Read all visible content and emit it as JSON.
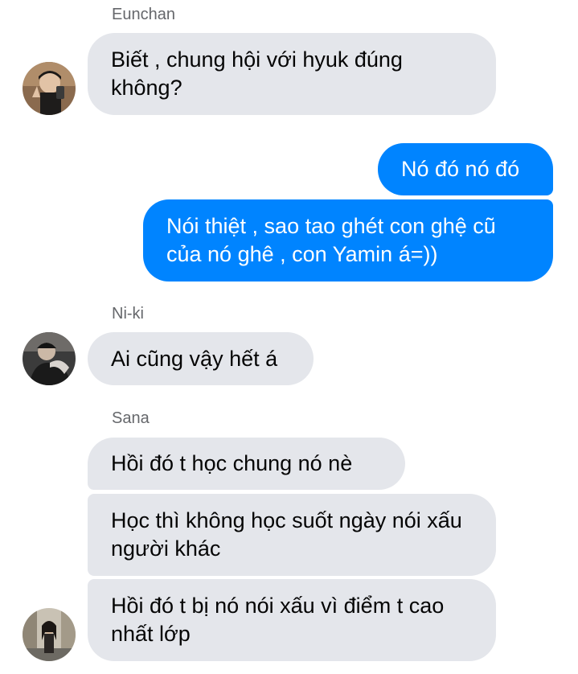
{
  "groups": [
    {
      "sender": "Eunchan",
      "avatar_icon": "user-avatar-eunchan",
      "messages": [
        {
          "text": "Biết , chung hội với hyuk đúng không?"
        }
      ]
    },
    {
      "sender": "me",
      "messages": [
        {
          "text": "Nó đó nó đó"
        },
        {
          "text": "Nói thiệt , sao tao ghét con ghệ cũ của nó ghê , con Yamin á=))"
        }
      ]
    },
    {
      "sender": "Ni-ki",
      "avatar_icon": "user-avatar-niki",
      "messages": [
        {
          "text": "Ai cũng vậy hết á"
        }
      ]
    },
    {
      "sender": "Sana",
      "avatar_icon": "user-avatar-sana",
      "messages": [
        {
          "text": "Hồi đó t học chung nó nè"
        },
        {
          "text": "Học thì không học suốt ngày nói xấu người khác"
        },
        {
          "text": "Hồi đó t bị nó nói xấu vì điểm t cao nhất lớp"
        }
      ]
    }
  ],
  "colors": {
    "incoming_bubble": "#e4e6eb",
    "outgoing_bubble": "#0084ff",
    "sender_name": "#65676b"
  }
}
